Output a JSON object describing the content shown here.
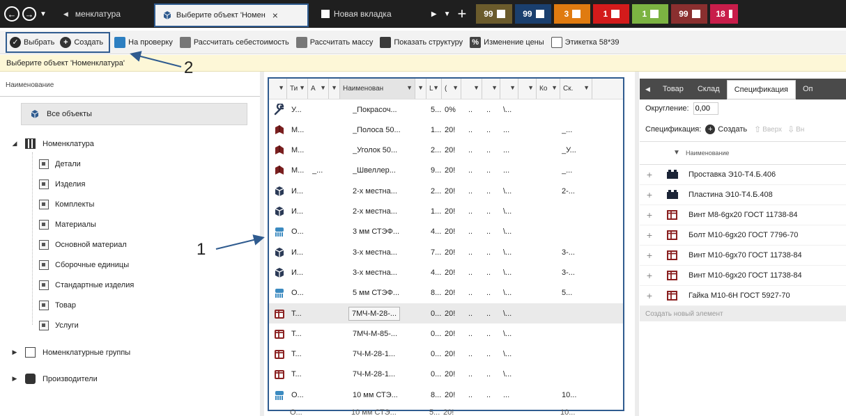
{
  "top_tabs": {
    "prev_tab": "менклатура",
    "active_tab": "Выберите объект 'Номен",
    "new_tab": "Новая вкладка",
    "close_glyph": "×",
    "plus_glyph": "+",
    "badges": [
      {
        "value": "99",
        "color": "#6b5b2c",
        "icon": "grid-icon"
      },
      {
        "value": "99",
        "color": "#1a3f6e",
        "icon": "sun-icon"
      },
      {
        "value": "3",
        "color": "#e07b10",
        "icon": "gear-icon"
      },
      {
        "value": "1",
        "color": "#d31b1b",
        "icon": "alert-icon"
      },
      {
        "value": "1",
        "color": "#7cb342",
        "icon": "send-icon"
      },
      {
        "value": "99",
        "color": "#8a2f2f",
        "icon": "chart-icon"
      },
      {
        "value": "18",
        "color": "#c81d4a",
        "icon": "bell-icon"
      }
    ]
  },
  "toolbar": {
    "select": "Выбрать",
    "create": "Создать",
    "review": "На проверку",
    "calc_cost": "Рассчитать себестоимость",
    "calc_mass": "Рассчитать массу",
    "show_structure": "Показать структуру",
    "price_change": "Изменение цены",
    "label": "Этикетка 58*39"
  },
  "hint": "Выберите объект 'Номенклатура'",
  "annotations": {
    "one": "1",
    "two": "2"
  },
  "left_panel": {
    "header": "Наименование",
    "all_objects": "Все объекты",
    "root": "Номенклатура",
    "children": [
      "Детали",
      "Изделия",
      "Комплекты",
      "Материалы",
      "Основной материал",
      "Сборочные единицы",
      "Стандартные изделия",
      "Товар",
      "Услуги"
    ],
    "groups": "Номенклатурные группы",
    "producers": "Производители"
  },
  "grid": {
    "headers": [
      "Ти",
      "А",
      "Наименован",
      "L",
      "(",
      "Ко",
      "Ск."
    ],
    "rows": [
      {
        "icon": "wrench-icon",
        "type": "У...",
        "a": "",
        "name": "_Покрасоч...",
        "l": "5...",
        "p": "0%",
        "c1": "..",
        "c2": "..",
        "c3": "\\...",
        "ko": "",
        "sk": ""
      },
      {
        "icon": "material-icon",
        "type": "М...",
        "a": "",
        "name": "_Полоса 50...",
        "l": "1...",
        "p": "20!",
        "c1": "..",
        "c2": "..",
        "c3": "...",
        "ko": "",
        "sk": "_..."
      },
      {
        "icon": "material-icon",
        "type": "М...",
        "a": "",
        "name": "_Уголок 50...",
        "l": "2...",
        "p": "20!",
        "c1": "..",
        "c2": "..",
        "c3": "...",
        "ko": "",
        "sk": "_У..."
      },
      {
        "icon": "material-icon",
        "type": "М...",
        "a": "_...",
        "name": "_Швеллер...",
        "l": "9...",
        "p": "20!",
        "c1": "..",
        "c2": "..",
        "c3": "...",
        "ko": "",
        "sk": "_..."
      },
      {
        "icon": "cube-icon",
        "type": "И...",
        "a": "",
        "name": "2-х местна...",
        "l": "2...",
        "p": "20!",
        "c1": "..",
        "c2": "..",
        "c3": "\\...",
        "ko": "",
        "sk": "2-..."
      },
      {
        "icon": "cube-icon",
        "type": "И...",
        "a": "",
        "name": "2-х местна...",
        "l": "1...",
        "p": "20!",
        "c1": "..",
        "c2": "..",
        "c3": "\\...",
        "ko": "",
        "sk": ""
      },
      {
        "icon": "basemat-icon",
        "type": "О...",
        "a": "",
        "name": "3 мм СТЭФ...",
        "l": "4...",
        "p": "20!",
        "c1": "..",
        "c2": "..",
        "c3": "\\...",
        "ko": "",
        "sk": ""
      },
      {
        "icon": "cube-icon",
        "type": "И...",
        "a": "",
        "name": "3-х местна...",
        "l": "7...",
        "p": "20!",
        "c1": "..",
        "c2": "..",
        "c3": "\\...",
        "ko": "",
        "sk": "3-..."
      },
      {
        "icon": "cube-icon",
        "type": "И...",
        "a": "",
        "name": "3-х местна...",
        "l": "4...",
        "p": "20!",
        "c1": "..",
        "c2": "..",
        "c3": "\\...",
        "ko": "",
        "sk": "3-..."
      },
      {
        "icon": "basemat-icon",
        "type": "О...",
        "a": "",
        "name": "5 мм СТЭФ...",
        "l": "8...",
        "p": "20!",
        "c1": "..",
        "c2": "..",
        "c3": "\\...",
        "ko": "",
        "sk": "5..."
      },
      {
        "icon": "product-icon",
        "type": "Т...",
        "a": "",
        "name": "7МЧ-М-28-...",
        "l": "0...",
        "p": "20!",
        "c1": "..",
        "c2": "..",
        "c3": "\\...",
        "ko": "",
        "sk": "",
        "selected": true
      },
      {
        "icon": "product-icon",
        "type": "Т...",
        "a": "",
        "name": "7МЧ-М-85-...",
        "l": "0...",
        "p": "20!",
        "c1": "..",
        "c2": "..",
        "c3": "\\...",
        "ko": "",
        "sk": ""
      },
      {
        "icon": "product-icon",
        "type": "Т...",
        "a": "",
        "name": "7Ч-М-28-1...",
        "l": "0...",
        "p": "20!",
        "c1": "..",
        "c2": "..",
        "c3": "\\...",
        "ko": "",
        "sk": ""
      },
      {
        "icon": "product-icon",
        "type": "Т...",
        "a": "",
        "name": "7Ч-М-28-1...",
        "l": "0...",
        "p": "20!",
        "c1": "..",
        "c2": "..",
        "c3": "\\...",
        "ko": "",
        "sk": ""
      },
      {
        "icon": "basemat-icon",
        "type": "О...",
        "a": "",
        "name": "10 мм СТЭ...",
        "l": "8...",
        "p": "20!",
        "c1": "..",
        "c2": "..",
        "c3": "...",
        "ko": "",
        "sk": "10..."
      }
    ],
    "overflow_row": {
      "type": "О...",
      "name": "10 мм СТЭ...",
      "l": "5...",
      "p": "20!",
      "sk": "10..."
    }
  },
  "right_panel": {
    "tabs": [
      "Товар",
      "Склад",
      "Спецификация",
      "Оп"
    ],
    "active_tab": 2,
    "rounding_label": "Округление:",
    "rounding_value": "0,00",
    "spec_label": "Спецификация:",
    "spec_create": "Создать",
    "spec_up": "Вверх",
    "spec_down": "Вн",
    "col_header": "Наименование",
    "items": [
      {
        "name": "Проставка Э10-Т4.Б.406",
        "icon": "assembly-icon"
      },
      {
        "name": "Пластина Э10-Т4.Б.408",
        "icon": "assembly-icon"
      },
      {
        "name": "Винт М8-6gх20 ГОСТ 11738-84",
        "icon": "product-icon"
      },
      {
        "name": "Болт М10-6gх20 ГОСТ 7796-70",
        "icon": "product-icon"
      },
      {
        "name": "Винт М10-6gх70 ГОСТ 11738-84",
        "icon": "product-icon"
      },
      {
        "name": "Винт М10-6gх20 ГОСТ 11738-84",
        "icon": "product-icon"
      },
      {
        "name": "Гайка М10-6Н ГОСТ 5927-70",
        "icon": "product-icon"
      }
    ],
    "new_element": "Создать новый элемент"
  }
}
